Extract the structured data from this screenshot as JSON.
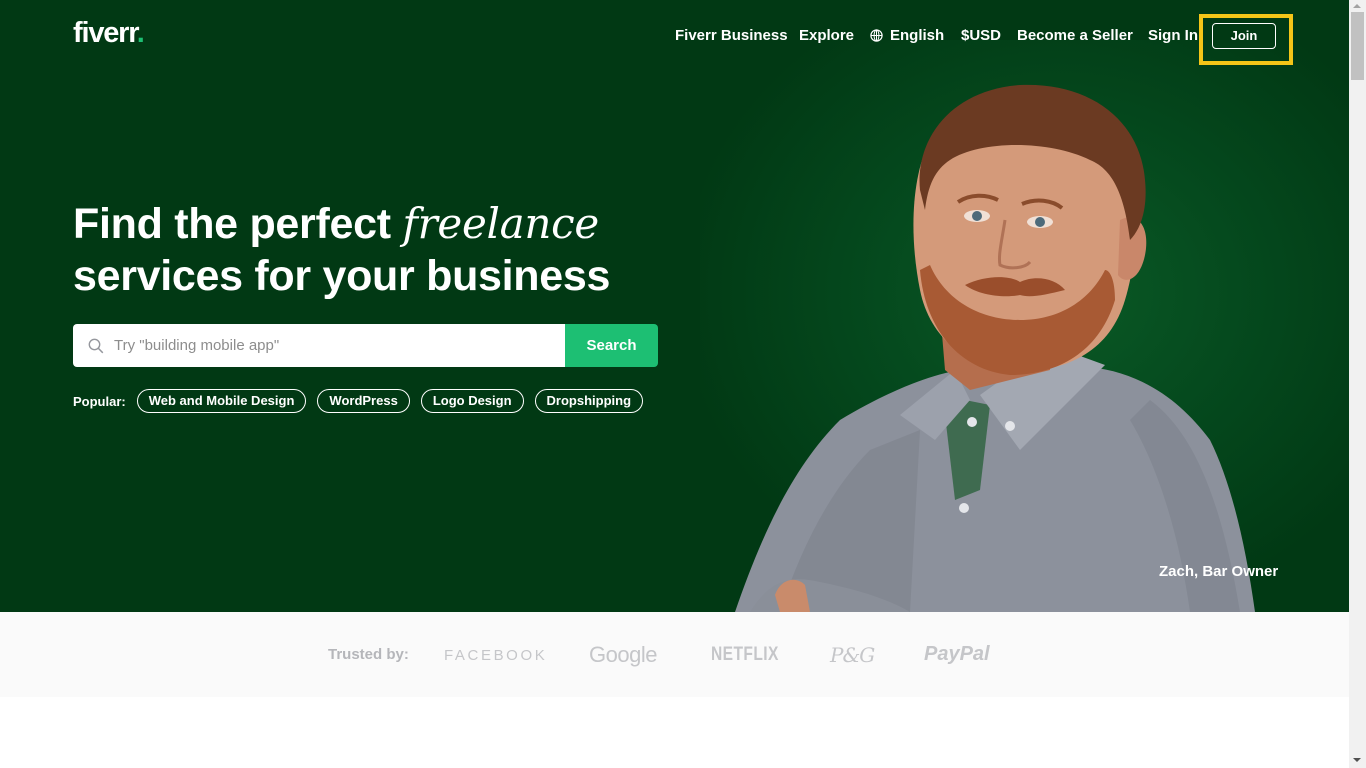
{
  "header": {
    "logo": "fiverr",
    "logo_dot": ".",
    "nav": {
      "business": "Fiverr Business",
      "explore": "Explore",
      "language": "English",
      "currency": "$USD",
      "become_seller": "Become a Seller",
      "sign_in": "Sign In",
      "join": "Join"
    },
    "icons": {
      "language": "globe-icon"
    }
  },
  "hero": {
    "headline_part1": "Find the perfect ",
    "headline_italic": "freelance",
    "headline_line2": "services for your business",
    "search": {
      "placeholder": "Try \"building mobile app\"",
      "value": "",
      "button_label": "Search",
      "icon": "search-icon"
    },
    "popular": {
      "label": "Popular:",
      "tags": [
        "Web and Mobile Design",
        "WordPress",
        "Logo Design",
        "Dropshipping"
      ]
    },
    "caption": "Zach, Bar Owner"
  },
  "trusted": {
    "label": "Trusted by:",
    "brands": [
      "FACEBOOK",
      "Google",
      "NETFLIX",
      "P&G",
      "PayPal"
    ]
  },
  "colors": {
    "hero_bg": "#013914",
    "brand_green": "#1dbf73",
    "highlight": "#f5c518",
    "trusted_bg": "#fafafa"
  }
}
